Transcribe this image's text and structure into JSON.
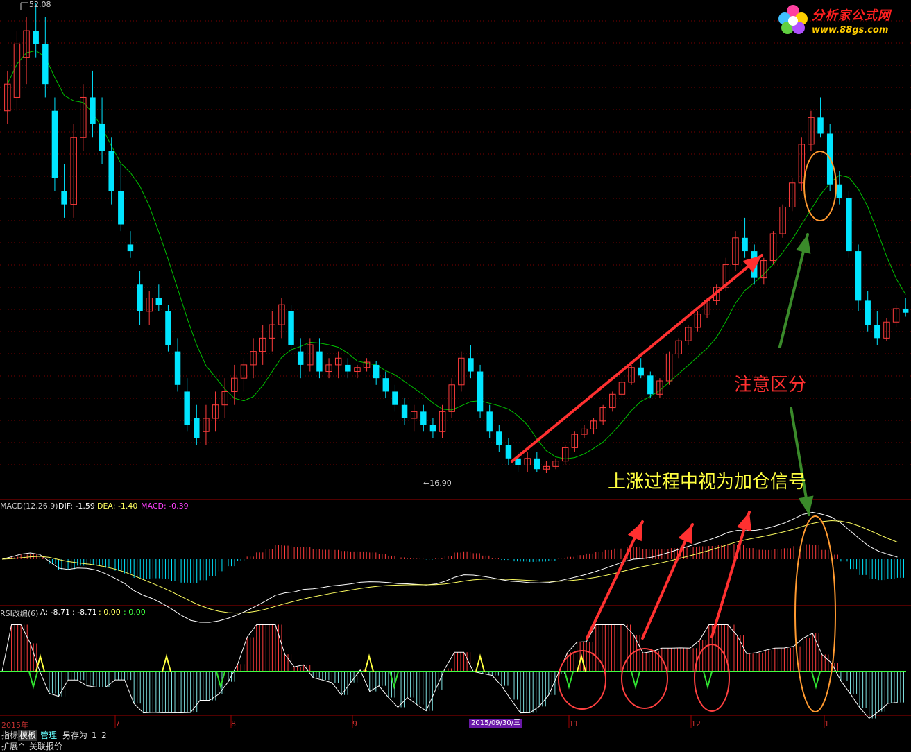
{
  "price_panel": {
    "high_label": "52.08",
    "low_label": "←16.90"
  },
  "macd_header": {
    "name": "MACD(12,26,9)",
    "dif": "DIF: -1.59",
    "dea": "DEA: -1.40",
    "macd": "MACD: -0.39"
  },
  "rsi_header": {
    "name": "RSI改编(6)",
    "a": "A: -8.71",
    "b": ": -8.71",
    "c": ": 0.00",
    "d": ": 0.00"
  },
  "x_axis": {
    "labels": [
      "2015年",
      "7",
      "8",
      "9",
      "11",
      "12",
      "1"
    ],
    "badge": "2015/09/30/三"
  },
  "annotations": {
    "note_distinguish": "注意区分",
    "note_signal": "上涨过程中视为加仓信号"
  },
  "logo": {
    "title": "分析家公式网",
    "url": "www.88gs.com"
  },
  "toolbar": {
    "items": [
      "指标",
      "模板",
      "管理",
      "另存为",
      "1",
      "2"
    ],
    "row2": [
      "扩展^",
      "关联报价"
    ]
  },
  "colors": {
    "up": "#ff3c3c",
    "down": "#00e5ff",
    "ma": "#00c000",
    "grid": "#7a0000",
    "macd_dif": "#ffffff",
    "macd_dea": "#ffff60",
    "rsi_line": "#ffffff",
    "rsi_zero": "#40ff40",
    "arrow_red": "#ff3030",
    "arrow_green": "#3a8a2a",
    "circle_red": "#ff4040",
    "circle_orange": "#ff9a30",
    "note_red": "#ff3030",
    "note_yellow": "#ffff40"
  },
  "chart_data": [
    {
      "type": "candlestick",
      "title": "",
      "ylim": [
        16.9,
        52.08
      ],
      "series": [
        {
          "ohlc": [
            [
              44,
              47,
              43,
              46
            ],
            [
              45,
              50,
              44,
              49
            ],
            [
              48,
              51,
              46,
              50
            ],
            [
              50,
              52.08,
              48,
              49
            ],
            [
              49,
              51,
              45,
              46
            ],
            [
              44,
              45,
              38,
              39
            ],
            [
              38,
              40,
              36,
              37
            ],
            [
              37,
              43,
              36,
              42
            ],
            [
              42,
              46,
              41,
              45
            ],
            [
              45,
              47,
              42,
              43
            ],
            [
              43,
              45,
              40,
              41
            ],
            [
              41,
              42,
              37,
              38
            ],
            [
              38,
              40,
              35,
              35.5
            ],
            [
              34,
              35,
              33,
              33.5
            ],
            [
              31,
              32,
              28,
              29
            ],
            [
              29,
              30.5,
              28,
              30
            ],
            [
              30,
              31,
              29,
              29.5
            ],
            [
              29,
              29.5,
              26,
              26.5
            ],
            [
              26,
              27,
              23,
              23.5
            ],
            [
              23,
              24,
              20,
              20.5
            ],
            [
              21,
              22,
              19,
              19.5
            ],
            [
              20,
              22,
              19,
              21
            ],
            [
              21,
              23,
              20,
              22
            ],
            [
              22,
              24,
              21,
              23
            ],
            [
              23,
              25,
              22,
              24
            ],
            [
              24,
              25.5,
              23,
              25
            ],
            [
              25,
              27,
              24,
              26
            ],
            [
              26,
              28,
              25,
              27
            ],
            [
              27,
              29,
              26,
              28
            ],
            [
              28,
              30,
              27,
              29.5
            ],
            [
              29,
              29.5,
              26,
              26.5
            ],
            [
              26,
              27,
              24,
              25
            ],
            [
              25,
              27,
              24.5,
              26.5
            ],
            [
              26,
              27,
              24,
              24.5
            ],
            [
              24.5,
              25.5,
              24,
              25
            ],
            [
              25,
              26,
              24,
              25.5
            ],
            [
              25,
              25.5,
              24,
              24.5
            ],
            [
              24.5,
              25,
              24,
              24.8
            ],
            [
              24.8,
              25.5,
              24.5,
              25.2
            ],
            [
              25,
              25.3,
              23.5,
              24
            ],
            [
              24,
              24.5,
              22.5,
              23
            ],
            [
              23,
              23.5,
              21.5,
              22
            ],
            [
              22,
              22.5,
              20.5,
              21
            ],
            [
              21,
              22,
              20,
              21.5
            ],
            [
              21.5,
              22,
              20,
              20.5
            ],
            [
              20.5,
              21,
              19.5,
              20
            ],
            [
              20,
              22,
              19.5,
              21.5
            ],
            [
              21.5,
              24,
              21,
              23.5
            ],
            [
              23.5,
              26,
              23,
              25.5
            ],
            [
              25.5,
              26.5,
              24,
              24.5
            ],
            [
              24.5,
              25,
              21,
              21.5
            ],
            [
              21.5,
              22,
              19.5,
              20
            ],
            [
              20,
              20.5,
              18.5,
              19
            ],
            [
              19,
              19.5,
              17.5,
              18
            ],
            [
              18,
              18.5,
              17,
              17.5
            ],
            [
              17.5,
              18.5,
              17,
              18
            ],
            [
              18,
              18.5,
              17,
              17.2
            ],
            [
              17.2,
              17.8,
              16.9,
              17.4
            ],
            [
              17.4,
              18,
              17.2,
              17.8
            ],
            [
              17.8,
              19,
              17.5,
              18.8
            ],
            [
              18.8,
              20,
              18.5,
              19.8
            ],
            [
              19.8,
              20.5,
              19.5,
              20.2
            ],
            [
              20.2,
              21,
              19.8,
              20.8
            ],
            [
              20.8,
              22,
              20.5,
              21.8
            ],
            [
              21.8,
              23,
              21.5,
              22.8
            ],
            [
              22.8,
              24,
              22.5,
              23.7
            ],
            [
              23.7,
              25,
              23.5,
              24.8
            ],
            [
              24.8,
              25.5,
              24,
              24.2
            ],
            [
              24.2,
              24.5,
              22.5,
              22.8
            ],
            [
              22.8,
              24,
              22.5,
              23.8
            ],
            [
              23.8,
              26,
              23.5,
              25.8
            ],
            [
              25.8,
              27,
              25.5,
              26.8
            ],
            [
              26.8,
              28,
              26.5,
              27.8
            ],
            [
              27.8,
              29,
              27.5,
              28.8
            ],
            [
              28.8,
              30,
              28.5,
              29.8
            ],
            [
              29.8,
              31,
              29.5,
              30.8
            ],
            [
              30.8,
              33,
              30.5,
              32.5
            ],
            [
              32.5,
              35,
              32,
              34.5
            ],
            [
              34.5,
              36,
              33,
              33.5
            ],
            [
              33.5,
              34,
              31,
              31.5
            ],
            [
              31.5,
              33,
              31,
              32.8
            ],
            [
              32.8,
              35,
              32.5,
              34.8
            ],
            [
              34.8,
              37,
              34.5,
              36.8
            ],
            [
              36.8,
              39,
              36.5,
              38.6
            ],
            [
              38.6,
              42,
              38,
              41.5
            ],
            [
              41.5,
              44,
              41,
              43.5
            ],
            [
              43.5,
              45,
              42,
              42.3
            ],
            [
              42.3,
              43,
              38,
              38.5
            ],
            [
              38.5,
              39.5,
              37,
              37.5
            ],
            [
              37.5,
              38,
              33,
              33.5
            ],
            [
              33.5,
              34,
              29,
              29.8
            ],
            [
              29.8,
              30.5,
              27.5,
              28
            ],
            [
              28,
              29,
              26.5,
              27
            ],
            [
              27,
              28.5,
              26.8,
              28.2
            ],
            [
              28.2,
              29.5,
              27.8,
              29.2
            ],
            [
              29.2,
              30,
              28.6,
              28.9
            ]
          ]
        },
        {
          "name": "",
          "values": []
        }
      ]
    },
    {
      "type": "bar",
      "title": "MACD(12,26,9)",
      "series": [
        {
          "name": "DIF",
          "values": [
            -1.59
          ]
        },
        {
          "name": "DEA",
          "values": [
            -1.4
          ]
        },
        {
          "name": "MACD",
          "values": [
            -0.39
          ]
        }
      ]
    },
    {
      "type": "bar",
      "title": "RSI改编(6)",
      "series": [
        {
          "name": "A",
          "values": [
            -8.71
          ]
        }
      ]
    }
  ]
}
